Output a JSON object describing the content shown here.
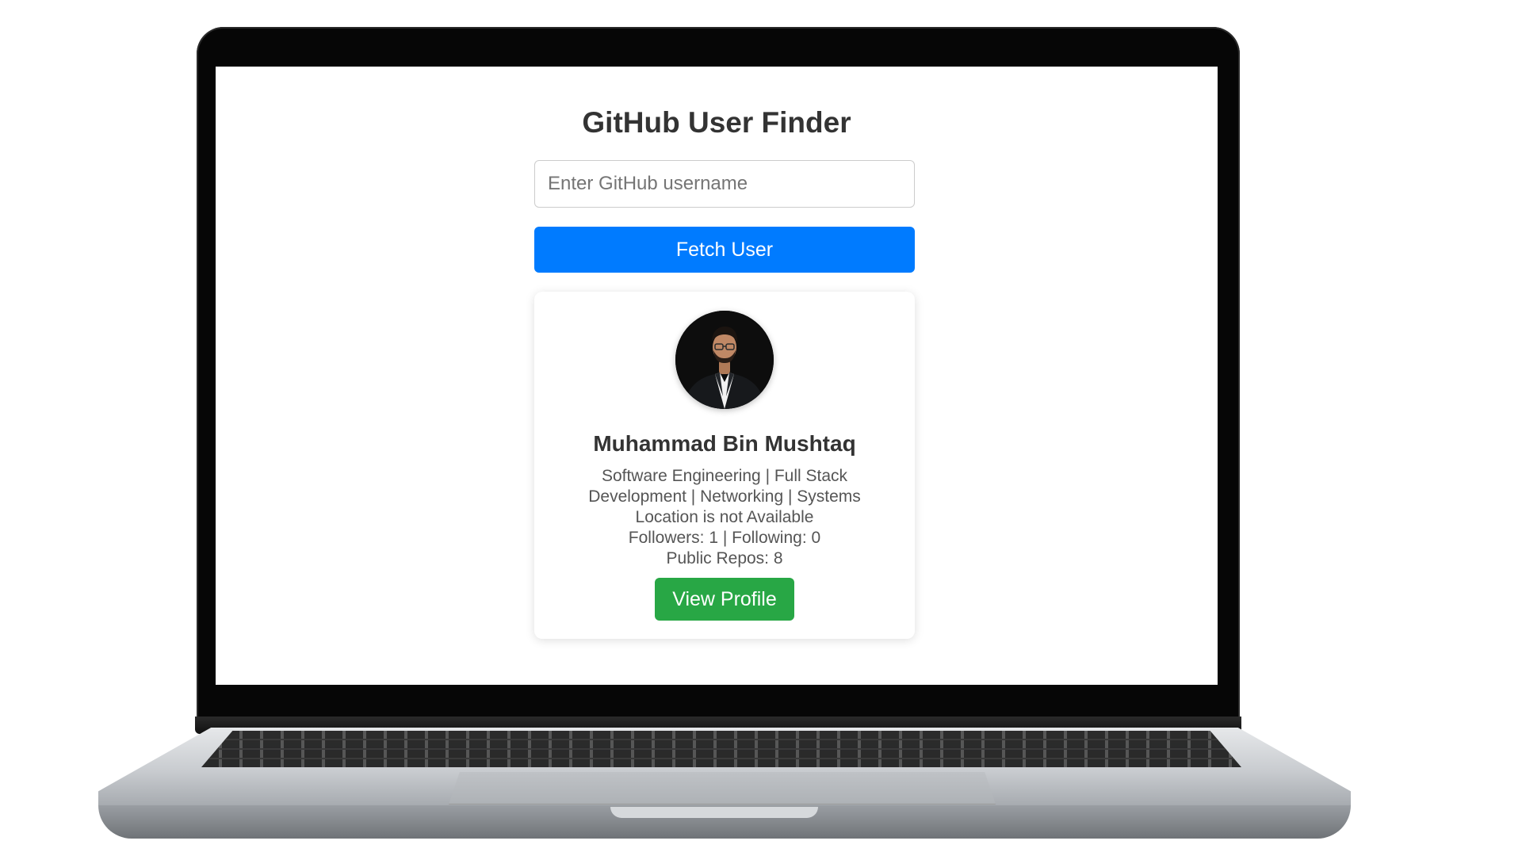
{
  "app": {
    "title": "GitHub User Finder"
  },
  "search": {
    "placeholder": "Enter GitHub username",
    "value": "",
    "button_label": "Fetch User"
  },
  "profile": {
    "name": "Muhammad Bin Mushtaq",
    "bio": "Software Engineering | Full Stack Development | Networking | Systems",
    "location": "Location is not Available",
    "follow_stats": "Followers: 1 | Following: 0",
    "public_repos": "Public Repos: 8",
    "view_profile_label": "View Profile",
    "avatar_icon": "user-avatar-photo"
  },
  "colors": {
    "fetch_button": "#007bff",
    "view_profile_button": "#28a745",
    "title_text": "#333333",
    "body_text": "#555555"
  }
}
